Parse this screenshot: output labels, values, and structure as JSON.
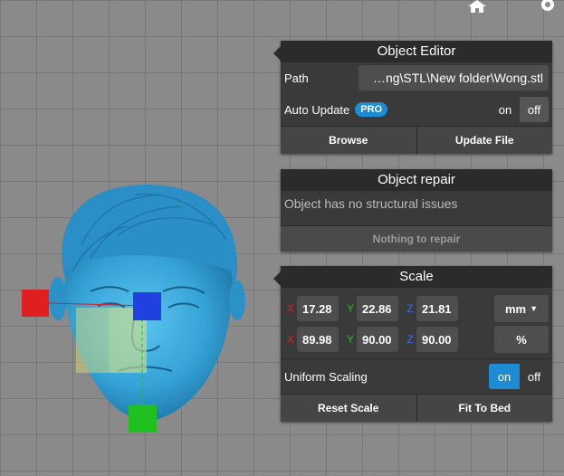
{
  "toolbar": {
    "home_icon": "home-icon",
    "settings_icon": "gear-icon"
  },
  "object_editor": {
    "title": "Object Editor",
    "path_label": "Path",
    "path_value": "…ng\\STL\\New folder\\Wong.stl",
    "auto_update_label": "Auto Update",
    "pro_badge": "PRO",
    "auto_update_on": "on",
    "auto_update_off": "off",
    "browse_button": "Browse",
    "update_file_button": "Update File"
  },
  "object_repair": {
    "title": "Object repair",
    "status_text": "Object has no structural issues",
    "repair_button": "Nothing to repair"
  },
  "scale": {
    "title": "Scale",
    "size_row": {
      "x_label": "X",
      "x": "17.28",
      "y_label": "Y",
      "y": "22.86",
      "z_label": "Z",
      "z": "21.81",
      "unit": "mm"
    },
    "percent_row": {
      "x_label": "X",
      "x": "89.98",
      "y_label": "Y",
      "y": "90.00",
      "z_label": "Z",
      "z": "90.00",
      "unit": "%"
    },
    "uniform_label": "Uniform Scaling",
    "uniform_on": "on",
    "uniform_off": "off",
    "reset_button": "Reset Scale",
    "fit_button": "Fit To Bed"
  },
  "colors": {
    "accent": "#1e8cd4",
    "x_axis": "#e02020",
    "y_axis": "#20c020",
    "z_axis": "#2040e0",
    "model": "#3aa6d8"
  }
}
